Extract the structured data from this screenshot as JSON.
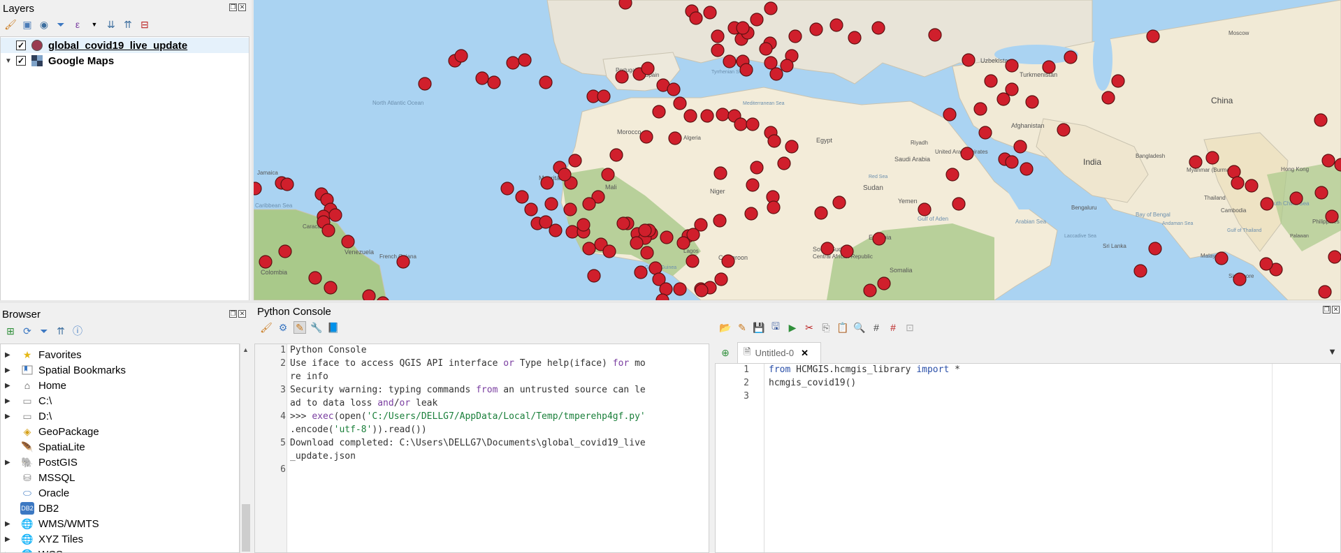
{
  "layers": {
    "title": "Layers",
    "items": [
      {
        "name": "global_covid19_live_update",
        "checked": true,
        "symbol_color": "#9a3b4f",
        "selected": true
      },
      {
        "name": "Google Maps",
        "checked": true,
        "symbol": "xyz-tiles-icon"
      }
    ]
  },
  "map": {
    "point_color": "#d01f2c",
    "labels": {
      "north_atlantic": "North Atlantic Ocean",
      "portugal": "Portugal",
      "spain": "Spain",
      "morocco": "Morocco",
      "algeria": "Algeria",
      "mauritania": "Mauritania",
      "mali": "Mali",
      "niger": "Niger",
      "sudan": "Sudan",
      "south_sudan": "South Sudan",
      "egypt": "Egypt",
      "saudi_arabia": "Saudi Arabia",
      "yemen": "Yemen",
      "somalia": "Somalia",
      "ethiopia": "Ethiopia",
      "uzbekistan": "Uzbekistan",
      "turkmenistan": "Turkmenistan",
      "afghanistan": "Afghanistan",
      "india": "India",
      "china": "China",
      "caracas": "Caracas",
      "venezuela": "Venezuela",
      "colombia": "Colombia",
      "french_guiana": "French Guiana",
      "cameroon": "Cameroon",
      "car": "Central African Republic",
      "gulf_of_aden": "Gulf of Aden",
      "arabian_sea": "Arabian Sea",
      "bay_of_bengal": "Bay of Bengal",
      "bengaluru": "Bengaluru",
      "sri_lanka": "Sri Lanka",
      "thailand": "Thailand",
      "cambodia": "Cambodia",
      "malaysia": "Malaysia",
      "singapore": "Singapore",
      "south_china_sea": "South China Sea",
      "hong_kong": "Hong Kong",
      "caribbean_sea": "Caribbean Sea",
      "riyadh": "Riyadh",
      "lagos": "Lagos",
      "myanmar": "Myanmar (Burma)",
      "bangladesh": "Bangladesh",
      "laccadive_sea": "Laccadive Sea",
      "andaman_sea": "Andaman Sea",
      "gulf_of_guinea": "Gulf of Guinea",
      "tyrrhenian_sea": "Tyrrhenian Sea",
      "mediterranean_sea": "Mediterranean Sea",
      "gulf_of_thailand": "Gulf of Thailand",
      "palawan": "Palawan",
      "philippines": "Philippines",
      "moscow": "Moscow",
      "united_arab_emirates": "United Arab Emirates",
      "red_sea": "Red Sea",
      "jamaica": "Jamaica"
    }
  },
  "browser": {
    "title": "Browser",
    "items": [
      {
        "label": "Favorites",
        "icon": "star-icon",
        "expandable": true
      },
      {
        "label": "Spatial Bookmarks",
        "icon": "bookmarks-icon",
        "expandable": true
      },
      {
        "label": "Home",
        "icon": "home-icon",
        "expandable": true
      },
      {
        "label": "C:\\",
        "icon": "folder-icon",
        "expandable": true
      },
      {
        "label": "D:\\",
        "icon": "folder-icon",
        "expandable": true
      },
      {
        "label": "GeoPackage",
        "icon": "geopackage-icon",
        "expandable": false
      },
      {
        "label": "SpatiaLite",
        "icon": "spatialite-icon",
        "expandable": false
      },
      {
        "label": "PostGIS",
        "icon": "postgis-icon",
        "expandable": true
      },
      {
        "label": "MSSQL",
        "icon": "mssql-icon",
        "expandable": false
      },
      {
        "label": "Oracle",
        "icon": "oracle-icon",
        "expandable": false
      },
      {
        "label": "DB2",
        "icon": "db2-icon",
        "expandable": false
      },
      {
        "label": "WMS/WMTS",
        "icon": "wms-icon",
        "expandable": true
      },
      {
        "label": "XYZ Tiles",
        "icon": "xyz-icon",
        "expandable": true
      },
      {
        "label": "WCS",
        "icon": "wcs-icon",
        "expandable": true
      }
    ]
  },
  "console": {
    "title": "Python Console",
    "lines": [
      {
        "n": "1",
        "segments": [
          {
            "t": "Python Console",
            "c": ""
          }
        ]
      },
      {
        "n": "2",
        "segments": [
          {
            "t": "Use iface to access QGIS API interface ",
            "c": ""
          },
          {
            "t": "or",
            "c": "kw"
          },
          {
            "t": " Type help(iface) ",
            "c": ""
          },
          {
            "t": "for",
            "c": "kw"
          },
          {
            "t": " mo",
            "c": ""
          }
        ]
      },
      {
        "n": "",
        "segments": [
          {
            "t": "re info",
            "c": ""
          }
        ]
      },
      {
        "n": "3",
        "segments": [
          {
            "t": "Security warning: typing commands ",
            "c": ""
          },
          {
            "t": "from",
            "c": "kw"
          },
          {
            "t": " an untrusted source can le",
            "c": ""
          }
        ]
      },
      {
        "n": "",
        "segments": [
          {
            "t": "ad to data loss ",
            "c": ""
          },
          {
            "t": "and",
            "c": "kw"
          },
          {
            "t": "/",
            "c": ""
          },
          {
            "t": "or",
            "c": "kw"
          },
          {
            "t": " leak",
            "c": ""
          }
        ]
      },
      {
        "n": "4",
        "segments": [
          {
            "t": ">>> ",
            "c": ""
          },
          {
            "t": "exec",
            "c": "fn"
          },
          {
            "t": "(open(",
            "c": ""
          },
          {
            "t": "'C:/Users/DELLG7/AppData/Local/Temp/tmperehp4gf.py'",
            "c": "str"
          }
        ]
      },
      {
        "n": "",
        "segments": [
          {
            "t": ".encode(",
            "c": ""
          },
          {
            "t": "'utf-8'",
            "c": "str"
          },
          {
            "t": ")).read())",
            "c": ""
          }
        ]
      },
      {
        "n": "5",
        "segments": [
          {
            "t": "Download completed: C:\\Users\\DELLG7\\Documents\\global_covid19_live",
            "c": ""
          }
        ]
      },
      {
        "n": "",
        "segments": [
          {
            "t": "_update.json",
            "c": ""
          }
        ]
      },
      {
        "n": "6",
        "segments": []
      }
    ]
  },
  "editor": {
    "tab_label": "Untitled-0",
    "lines": [
      {
        "n": "1",
        "segments": [
          {
            "t": "from",
            "c": "kw2"
          },
          {
            "t": " HCMGIS.hcmgis_library ",
            "c": ""
          },
          {
            "t": "import",
            "c": "kw2"
          },
          {
            "t": " *",
            "c": ""
          }
        ]
      },
      {
        "n": "2",
        "segments": [
          {
            "t": "hcmgis_covid19()",
            "c": ""
          }
        ]
      },
      {
        "n": "3",
        "segments": []
      }
    ]
  }
}
